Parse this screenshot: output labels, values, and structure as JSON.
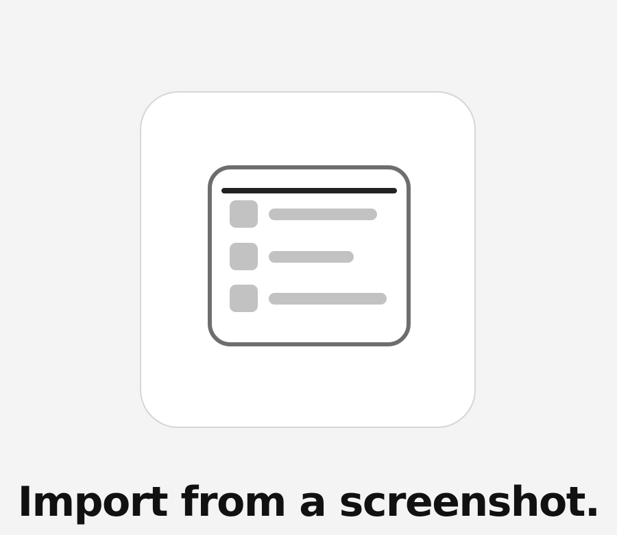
{
  "headline": {
    "text": "Import from a screenshot."
  },
  "illustration": {
    "icon": "screenshot-list-window-icon",
    "rows": 3
  },
  "colors": {
    "background": "#f4f4f4",
    "card": "#ffffff",
    "card_border": "#d6d6d6",
    "window_border": "#6e6e6e",
    "title_bar": "#222222",
    "placeholder": "#c2c2c2",
    "text": "#111111"
  }
}
